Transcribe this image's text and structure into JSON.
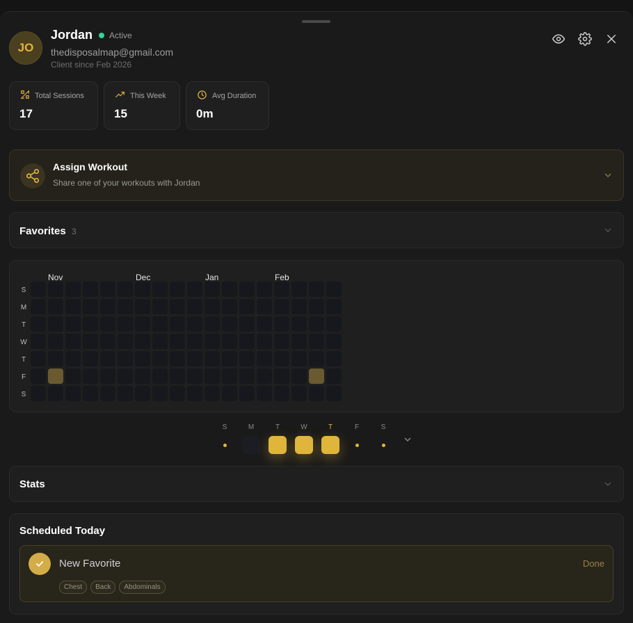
{
  "client": {
    "initials": "JO",
    "name": "Jordan",
    "status": "Active",
    "email": "thedisposalmap@gmail.com",
    "since": "Client since Feb 2026"
  },
  "header_icons": [
    "eye-icon",
    "gear-icon",
    "close-icon"
  ],
  "stats_cards": [
    {
      "label": "Total Sessions",
      "value": "17",
      "icon": "sessions-icon"
    },
    {
      "label": "This Week",
      "value": "15",
      "icon": "trending-up-icon"
    },
    {
      "label": "Avg Duration",
      "value": "0m",
      "icon": "clock-icon"
    }
  ],
  "assign": {
    "title": "Assign Workout",
    "subtitle": "Share one of your workouts with Jordan"
  },
  "favorites": {
    "title": "Favorites",
    "count": "3"
  },
  "heatmap": {
    "months": [
      "Nov",
      "Dec",
      "Jan",
      "Feb"
    ],
    "day_labels": [
      "S",
      "M",
      "T",
      "W",
      "T",
      "F",
      "S"
    ],
    "weeks": 18,
    "active_cells": [
      [
        1,
        5
      ],
      [
        16,
        5
      ]
    ]
  },
  "week_strip": {
    "labels": [
      "S",
      "M",
      "T",
      "W",
      "T",
      "F",
      "S"
    ],
    "today_index": 4,
    "days": [
      "dot",
      "empty",
      "done",
      "done",
      "done",
      "dot",
      "dot"
    ]
  },
  "stats_section": {
    "title": "Stats"
  },
  "scheduled": {
    "title": "Scheduled Today",
    "item": {
      "name": "New Favorite",
      "action": "Done",
      "tags": [
        "Chest",
        "Back",
        "Abdominals"
      ]
    }
  },
  "colors": {
    "accent": "#e0b53c",
    "active_dot": "#34d399",
    "background": "#1a1a1a"
  }
}
